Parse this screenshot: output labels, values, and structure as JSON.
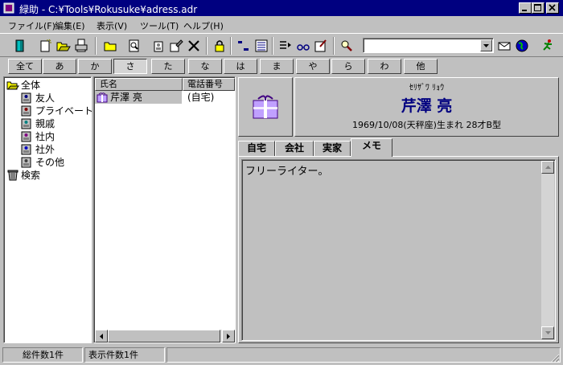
{
  "window": {
    "title": "緑助 - C:¥Tools¥Rokusuke¥adress.adr"
  },
  "menu": [
    "ファイル(F)",
    "編集(E)",
    "表示(V)",
    "ツール(T)",
    "ヘルプ(H)"
  ],
  "toolbar": {
    "search_value": ""
  },
  "index_tabs": [
    "全て",
    "あ",
    "か",
    "さ",
    "た",
    "な",
    "は",
    "ま",
    "や",
    "ら",
    "わ",
    "他"
  ],
  "active_index": "さ",
  "tree": {
    "root": "全体",
    "groups": [
      "友人",
      "プライベート",
      "親戚",
      "社内",
      "社外",
      "その他"
    ],
    "search": "検索"
  },
  "list": {
    "columns": [
      "氏名",
      "電話番号"
    ],
    "rows": [
      {
        "name": "芹澤  亮",
        "phone": "(自宅)"
      }
    ]
  },
  "detail": {
    "furigana": "ｾﾘｻﾞﾜ ﾘｮｳ",
    "name": "芹澤  亮",
    "birth": "1969/10/08(天秤座)生まれ  28才B型",
    "tabs": [
      "自宅",
      "会社",
      "実家",
      "メモ"
    ],
    "active_tab": "メモ",
    "memo": "フリーライター。"
  },
  "status": {
    "total": "総件数1件",
    "shown": "表示件数1件"
  }
}
